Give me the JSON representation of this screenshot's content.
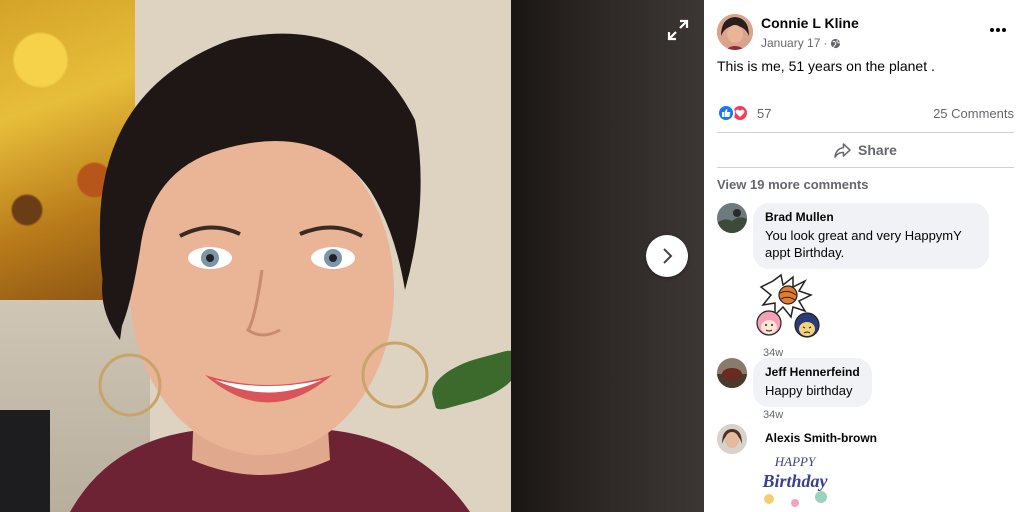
{
  "post": {
    "author": "Connie L Kline",
    "date": "January 17",
    "separator": "·",
    "privacy_icon": "globe-icon",
    "text": "This is me, 51 years on the planet .",
    "reactions": {
      "count": "57",
      "types": [
        "like",
        "love"
      ]
    },
    "comments_count": "25 Comments",
    "share_label": "Share",
    "more_options_icon": "ellipsis-icon"
  },
  "comments": {
    "view_more": "View 19 more comments",
    "items": [
      {
        "author": "Brad Mullen",
        "text": "You look great and very HappymY appt Birthday.",
        "time": "34w",
        "sticker": "cartoon-kids-sticker"
      },
      {
        "author": "Jeff Hennerfeind",
        "text": "Happy birthday",
        "time": "34w"
      },
      {
        "author": "Alexis Smith-brown",
        "sticker": "happy-birthday-sticker",
        "sticker_text": "HAPPY Birthday"
      }
    ]
  },
  "viewer": {
    "expand_icon": "expand-icon",
    "next_icon": "chevron-right-icon"
  },
  "colors": {
    "accent": "#1877f2",
    "love": "#f33e58",
    "secondary_text": "#65676b",
    "bubble": "#f0f2f5"
  }
}
